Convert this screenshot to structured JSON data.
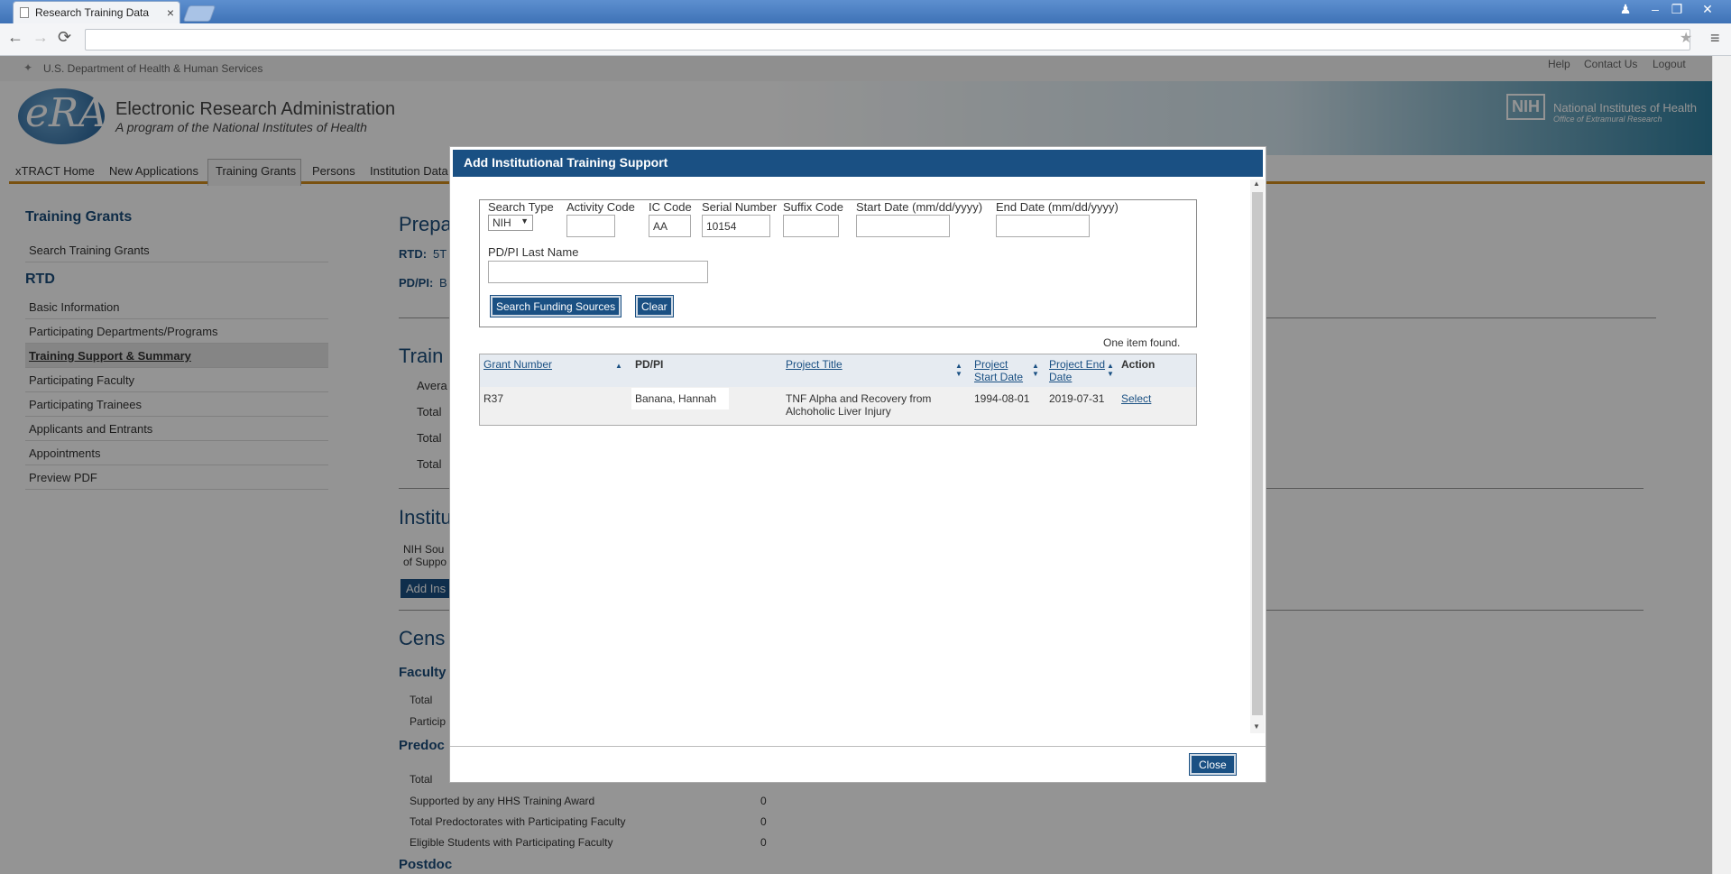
{
  "browser": {
    "tab_title": "Research Training Data",
    "tab_close": "×",
    "back": "←",
    "forward": "→",
    "reload": "⟳",
    "star": "★",
    "menu": "≡"
  },
  "header": {
    "hhs": "U.S. Department of Health & Human Services",
    "links": [
      "Help",
      "Contact Us",
      "Logout"
    ],
    "logo_text": "eRA",
    "title": "Electronic Research Administration",
    "subtitle": "A program of the National Institutes of Health",
    "nih_badge": "NIH",
    "nih_name": "National Institutes of Health",
    "nih_office": "Office of Extramural Research"
  },
  "nav": {
    "items": [
      "xTRACT Home",
      "New Applications",
      "Training Grants",
      "Persons",
      "Institution Data"
    ]
  },
  "sidebar": {
    "section1": "Training Grants",
    "search": "Search Training Grants",
    "section2": "RTD",
    "items": [
      "Basic Information",
      "Participating Departments/Programs",
      "Training Support & Summary",
      "Participating Faculty",
      "Participating Trainees",
      "Applicants and Entrants",
      "Appointments",
      "Preview PDF"
    ]
  },
  "main": {
    "heading1": "Prepa",
    "rtd_label": "RTD:",
    "rtd_value": "5T",
    "pdpi_label": "PD/PI:",
    "pdpi_value": "B",
    "heading2": "Train",
    "rows2": [
      "Avera",
      "Total",
      "Total",
      "Total"
    ],
    "heading3": "Institu",
    "nih_sources": "NIH Sou",
    "of_support": "of Suppo",
    "add_btn": "Add Ins",
    "heading4": "Cens",
    "faculty": "Faculty",
    "faculty_rows": [
      "Total",
      "Particip"
    ],
    "predoc": "Predoc",
    "predoc_rows": [
      {
        "label": "Total",
        "value": ""
      },
      {
        "label": "Supported by any HHS Training Award",
        "value": "0"
      },
      {
        "label": "Total Predoctorates with Participating Faculty",
        "value": "0"
      },
      {
        "label": "Eligible Students with Participating Faculty",
        "value": "0"
      }
    ],
    "postdoc": "Postdoc"
  },
  "dialog": {
    "title": "Add Institutional Training Support",
    "labels": {
      "search_type": "Search Type",
      "activity_code": "Activity Code",
      "ic_code": "IC Code",
      "serial_number": "Serial Number",
      "suffix_code": "Suffix Code",
      "start_date": "Start Date (mm/dd/yyyy)",
      "end_date": "End Date (mm/dd/yyyy)",
      "last_name": "PD/PI Last Name"
    },
    "values": {
      "search_type": "NIH",
      "activity_code": "",
      "ic_code": "AA",
      "serial_number": "10154",
      "suffix_code": "",
      "start_date": "",
      "end_date": "",
      "last_name": ""
    },
    "search_btn": "Search Funding Sources",
    "clear_btn": "Clear",
    "result_count": "One item found.",
    "columns": [
      "Grant Number",
      "PD/PI",
      "Project Title",
      "Project Start Date",
      "Project End Date",
      "Action"
    ],
    "col_start_1": "Project",
    "col_start_2": "Start Date",
    "col_end_1": "Project End",
    "col_end_2": "Date",
    "row": {
      "grant": "R37",
      "pdpi": "Banana, Hannah",
      "title_1": "TNF Alpha and Recovery from",
      "title_2": "Alchoholic Liver Injury",
      "start": "1994-08-01",
      "end": "2019-07-31",
      "action": "Select"
    },
    "close_btn": "Close"
  },
  "colors": {
    "brand": "#1a5083",
    "nav_accent": "#d08c1c"
  }
}
